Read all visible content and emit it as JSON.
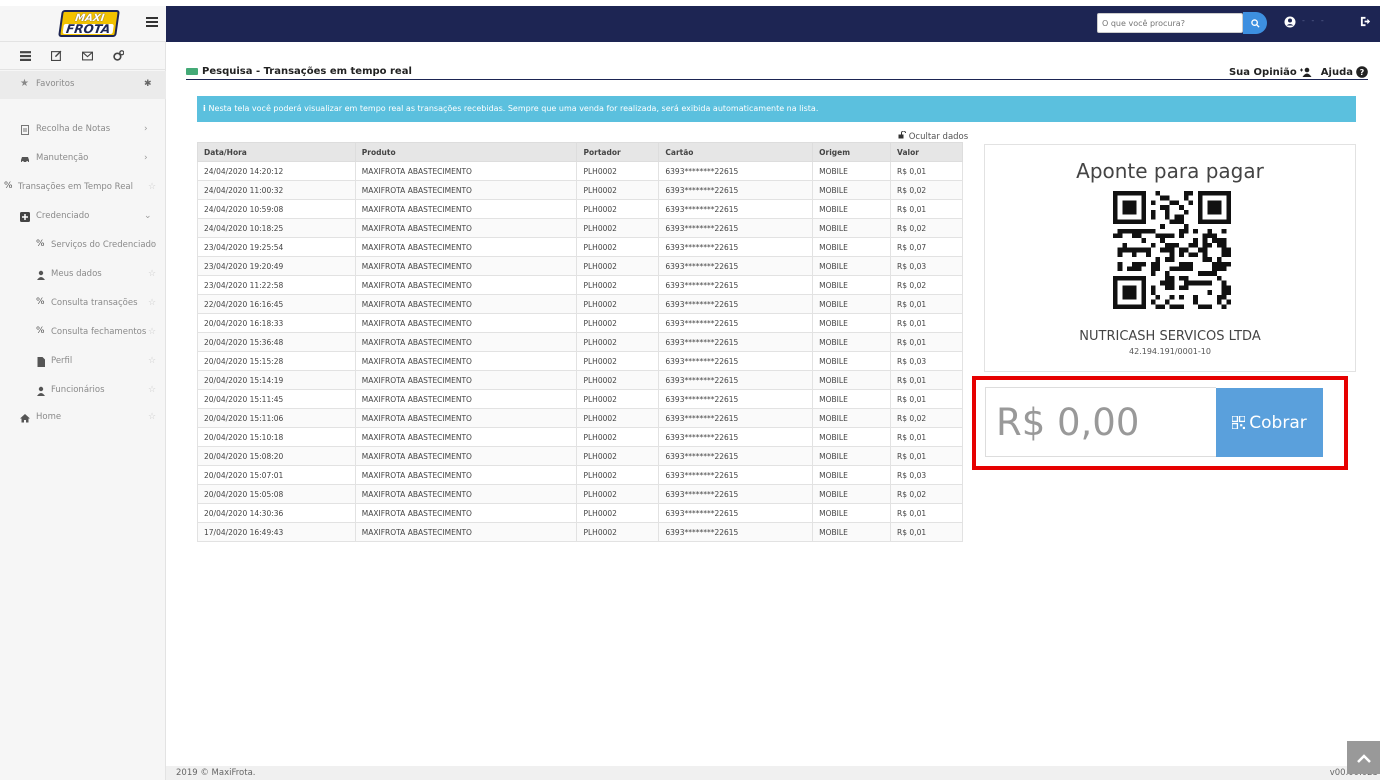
{
  "header": {
    "logo_line1": "MAXI",
    "logo_line2": "FROTA",
    "search_placeholder": "O que você procura?",
    "user_name": "- - -",
    "colors": {
      "navbar": "#1d2553",
      "search_button": "#3d8fe0"
    }
  },
  "sidebar": {
    "top_icons": [
      "list-icon",
      "edit-icon",
      "mail-icon",
      "gears-icon"
    ],
    "items": [
      {
        "label": "Favoritos",
        "icon": "star-icon",
        "trailing": "pin-icon"
      },
      {
        "label": "Recolha de Notas",
        "icon": "file-icon",
        "trailing": "›"
      },
      {
        "label": "Manutenção",
        "icon": "car-icon",
        "trailing": "›"
      },
      {
        "label": "Transações em Tempo Real",
        "icon": "percent-icon",
        "trailing": "☆"
      },
      {
        "label": "Credenciado",
        "icon": "plus-square-icon",
        "trailing": "⌄"
      },
      {
        "label": "Serviços do Credenciado",
        "icon": "percent-icon",
        "trailing": "☆"
      },
      {
        "label": "Meus dados",
        "icon": "user-icon",
        "trailing": "☆"
      },
      {
        "label": "Consulta transações",
        "icon": "percent-icon",
        "trailing": "☆"
      },
      {
        "label": "Consulta fechamentos",
        "icon": "percent-icon",
        "trailing": "☆"
      },
      {
        "label": "Perfil",
        "icon": "doc-icon",
        "trailing": "☆"
      },
      {
        "label": "Funcionários",
        "icon": "user-icon",
        "trailing": "☆"
      },
      {
        "label": "Home",
        "icon": "home-icon",
        "trailing": "☆"
      }
    ]
  },
  "page": {
    "title": "Pesquisa - Transações em tempo real",
    "feedback_label": "Sua Opinião",
    "help_label": "Ajuda",
    "info_text": "Nesta tela você poderá visualizar em tempo real as transações recebidas. Sempre que uma venda for realizada, será exibida automaticamente na lista.",
    "hide_data_label": "Ocultar dados"
  },
  "table": {
    "headers": [
      "Data/Hora",
      "Produto",
      "Portador",
      "Cartão",
      "Origem",
      "Valor"
    ],
    "rows": [
      [
        "24/04/2020 14:20:12",
        "MAXIFROTA ABASTECIMENTO",
        "PLH0002",
        "6393********22615",
        "MOBILE",
        "R$ 0,01"
      ],
      [
        "24/04/2020 11:00:32",
        "MAXIFROTA ABASTECIMENTO",
        "PLH0002",
        "6393********22615",
        "MOBILE",
        "R$ 0,02"
      ],
      [
        "24/04/2020 10:59:08",
        "MAXIFROTA ABASTECIMENTO",
        "PLH0002",
        "6393********22615",
        "MOBILE",
        "R$ 0,01"
      ],
      [
        "24/04/2020 10:18:25",
        "MAXIFROTA ABASTECIMENTO",
        "PLH0002",
        "6393********22615",
        "MOBILE",
        "R$ 0,02"
      ],
      [
        "23/04/2020 19:25:54",
        "MAXIFROTA ABASTECIMENTO",
        "PLH0002",
        "6393********22615",
        "MOBILE",
        "R$ 0,07"
      ],
      [
        "23/04/2020 19:20:49",
        "MAXIFROTA ABASTECIMENTO",
        "PLH0002",
        "6393********22615",
        "MOBILE",
        "R$ 0,03"
      ],
      [
        "23/04/2020 11:22:58",
        "MAXIFROTA ABASTECIMENTO",
        "PLH0002",
        "6393********22615",
        "MOBILE",
        "R$ 0,02"
      ],
      [
        "22/04/2020 16:16:45",
        "MAXIFROTA ABASTECIMENTO",
        "PLH0002",
        "6393********22615",
        "MOBILE",
        "R$ 0,01"
      ],
      [
        "20/04/2020 16:18:33",
        "MAXIFROTA ABASTECIMENTO",
        "PLH0002",
        "6393********22615",
        "MOBILE",
        "R$ 0,01"
      ],
      [
        "20/04/2020 15:36:48",
        "MAXIFROTA ABASTECIMENTO",
        "PLH0002",
        "6393********22615",
        "MOBILE",
        "R$ 0,01"
      ],
      [
        "20/04/2020 15:15:28",
        "MAXIFROTA ABASTECIMENTO",
        "PLH0002",
        "6393********22615",
        "MOBILE",
        "R$ 0,03"
      ],
      [
        "20/04/2020 15:14:19",
        "MAXIFROTA ABASTECIMENTO",
        "PLH0002",
        "6393********22615",
        "MOBILE",
        "R$ 0,01"
      ],
      [
        "20/04/2020 15:11:45",
        "MAXIFROTA ABASTECIMENTO",
        "PLH0002",
        "6393********22615",
        "MOBILE",
        "R$ 0,01"
      ],
      [
        "20/04/2020 15:11:06",
        "MAXIFROTA ABASTECIMENTO",
        "PLH0002",
        "6393********22615",
        "MOBILE",
        "R$ 0,02"
      ],
      [
        "20/04/2020 15:10:18",
        "MAXIFROTA ABASTECIMENTO",
        "PLH0002",
        "6393********22615",
        "MOBILE",
        "R$ 0,01"
      ],
      [
        "20/04/2020 15:08:20",
        "MAXIFROTA ABASTECIMENTO",
        "PLH0002",
        "6393********22615",
        "MOBILE",
        "R$ 0,01"
      ],
      [
        "20/04/2020 15:07:01",
        "MAXIFROTA ABASTECIMENTO",
        "PLH0002",
        "6393********22615",
        "MOBILE",
        "R$ 0,03"
      ],
      [
        "20/04/2020 15:05:08",
        "MAXIFROTA ABASTECIMENTO",
        "PLH0002",
        "6393********22615",
        "MOBILE",
        "R$ 0,02"
      ],
      [
        "20/04/2020 14:30:36",
        "MAXIFROTA ABASTECIMENTO",
        "PLH0002",
        "6393********22615",
        "MOBILE",
        "R$ 0,01"
      ],
      [
        "17/04/2020 16:49:43",
        "MAXIFROTA ABASTECIMENTO",
        "PLH0002",
        "6393********22615",
        "MOBILE",
        "R$ 0,01"
      ]
    ]
  },
  "qr_panel": {
    "title": "Aponte para pagar",
    "company": "NUTRICASH SERVICOS LTDA",
    "cnpj": "42.194.191/0001-10",
    "amount_value": "R$ 0,00",
    "charge_button": "Cobrar",
    "highlight_color": "#e60000",
    "button_color": "#5aa0dc"
  },
  "footer": {
    "copyright": "2019 © MaxiFrota.",
    "version": "v00.00.023"
  }
}
